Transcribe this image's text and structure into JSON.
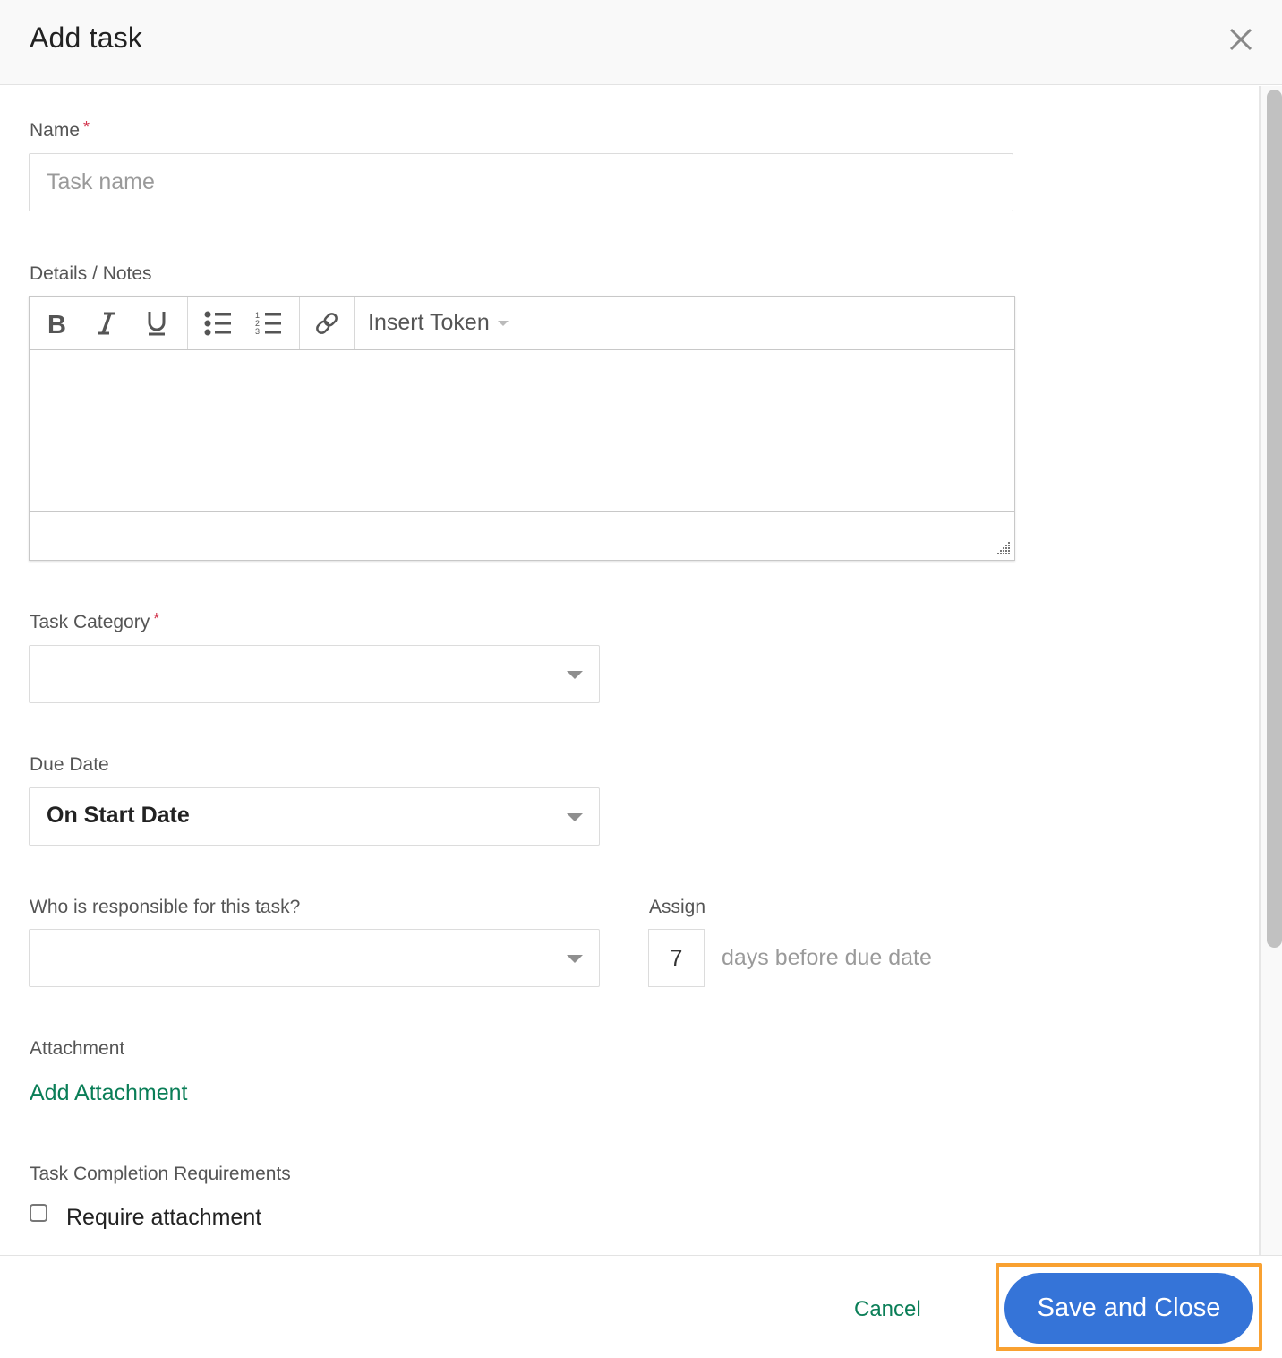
{
  "dialog": {
    "title": "Add task",
    "close_icon": "close-icon"
  },
  "form": {
    "name": {
      "label": "Name",
      "required_mark": "*",
      "placeholder": "Task name",
      "value": ""
    },
    "details": {
      "label": "Details / Notes",
      "toolbar": {
        "bold_icon": "bold-icon",
        "italic_icon": "italic-icon",
        "underline_icon": "underline-icon",
        "bullet_list_icon": "bulleted-list-icon",
        "numbered_list_icon": "numbered-list-icon",
        "link_icon": "link-icon",
        "insert_token_label": "Insert Token"
      },
      "value": ""
    },
    "task_category": {
      "label": "Task Category",
      "required_mark": "*",
      "value": ""
    },
    "due_date": {
      "label": "Due Date",
      "value": "On Start Date"
    },
    "responsible": {
      "label": "Who is responsible for this task?",
      "value": ""
    },
    "assign": {
      "label": "Assign",
      "days_value": "7",
      "suffix": "days before due date"
    },
    "attachment": {
      "label": "Attachment",
      "add_link": "Add Attachment"
    },
    "completion": {
      "label": "Task Completion Requirements",
      "require_attachment_label": "Require attachment",
      "require_attachment_checked": false
    }
  },
  "footer": {
    "cancel_label": "Cancel",
    "save_label": "Save and Close",
    "highlight_color": "#f9a131",
    "save_color": "#3574d8",
    "link_color": "#0a7e57"
  }
}
